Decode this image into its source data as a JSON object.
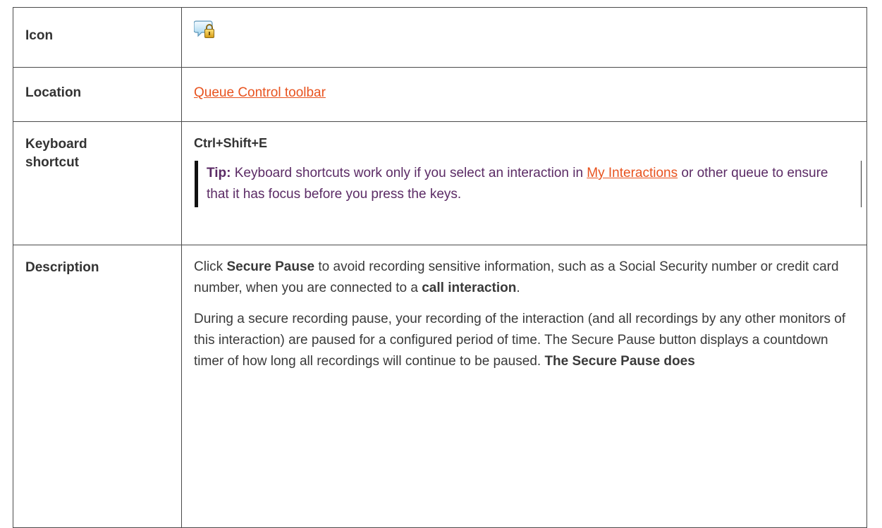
{
  "rows": {
    "icon": {
      "label": "Icon",
      "icon_name": "secure-pause-icon"
    },
    "location": {
      "label": "Location",
      "link_text": "Queue Control toolbar"
    },
    "keyboard": {
      "label": "Keyboard shortcut",
      "shortcut": "Ctrl+Shift+E",
      "tip_label": "Tip:",
      "tip_text_1": " Keyboard shortcuts work only if you select an interaction in ",
      "tip_link": "My Interactions",
      "tip_text_2": " or other queue to ensure that it has focus before you press the keys."
    },
    "description": {
      "label": "Description",
      "p1_a": "Click ",
      "p1_b": "Secure Pause",
      "p1_c": " to avoid recording sensitive information, such as a Social Security number or credit card number, when you are connected to a ",
      "p1_d": "call interaction",
      "p1_e": ".",
      "p2_a": "During a secure recording pause, your recording of the interaction (and all recordings by any other monitors of this interaction) are paused for a configured period of time. The Secure Pause button displays a countdown timer of how long all recordings will continue to be paused. ",
      "p2_b": "The Secure Pause does"
    }
  },
  "colors": {
    "link": "#e8531f",
    "tip_text": "#5b2b65",
    "border": "#4a4a4a"
  }
}
